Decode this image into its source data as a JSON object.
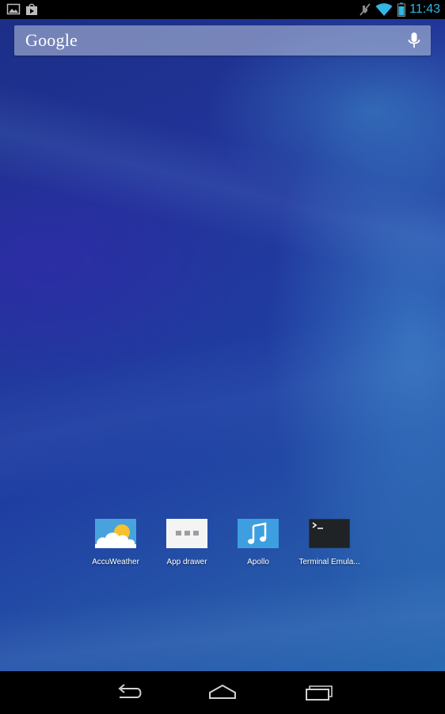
{
  "status_bar": {
    "time": "11:43",
    "left_icons": [
      "picture-icon",
      "play-store-icon"
    ],
    "right_icons": [
      "no-sync-icon",
      "wifi-icon",
      "battery-icon"
    ],
    "accent_color": "#33b5e5"
  },
  "search": {
    "logo_text": "Google",
    "mic_icon": "mic-icon"
  },
  "apps": [
    {
      "label": "AccuWeather",
      "icon": "accuweather-icon"
    },
    {
      "label": "App drawer",
      "icon": "app-drawer-icon"
    },
    {
      "label": "Apollo",
      "icon": "music-note-icon"
    },
    {
      "label": "Terminal Emula...",
      "icon": "terminal-icon"
    }
  ],
  "nav_bar": {
    "buttons": [
      "back-icon",
      "home-icon",
      "recents-icon"
    ]
  }
}
